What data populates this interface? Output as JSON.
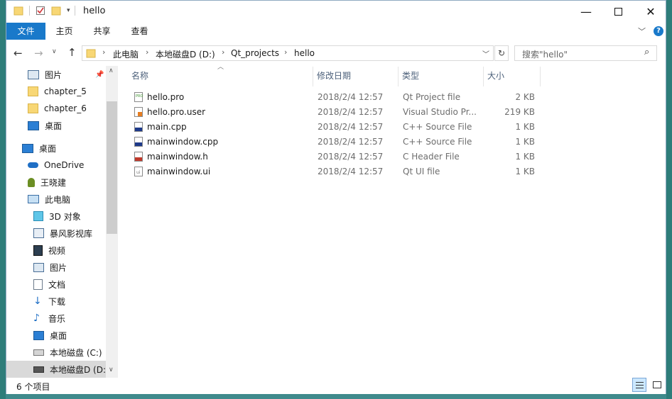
{
  "window": {
    "title": "hello"
  },
  "ribbon": {
    "tabs": [
      "文件",
      "主页",
      "共享",
      "查看"
    ]
  },
  "address": {
    "crumbs": [
      "此电脑",
      "本地磁盘D (D:)",
      "Qt_projects",
      "hello"
    ]
  },
  "search": {
    "placeholder": "搜索\"hello\""
  },
  "nav": {
    "items": [
      {
        "label": "图片",
        "icon": "pictures-icon"
      },
      {
        "label": "chapter_5",
        "icon": "folder-icon"
      },
      {
        "label": "chapter_6",
        "icon": "folder-icon"
      },
      {
        "label": "桌面",
        "icon": "desktop-icon"
      },
      {
        "label": "桌面",
        "icon": "desktop-icon"
      },
      {
        "label": "OneDrive",
        "icon": "onedrive-icon"
      },
      {
        "label": "王晓建",
        "icon": "user-icon"
      },
      {
        "label": "此电脑",
        "icon": "computer-icon"
      },
      {
        "label": "3D 对象",
        "icon": "3d-objects-icon"
      },
      {
        "label": "暴风影视库",
        "icon": "video-library-icon"
      },
      {
        "label": "视频",
        "icon": "video-icon"
      },
      {
        "label": "图片",
        "icon": "pictures-icon"
      },
      {
        "label": "文档",
        "icon": "documents-icon"
      },
      {
        "label": "下载",
        "icon": "downloads-icon"
      },
      {
        "label": "音乐",
        "icon": "music-icon"
      },
      {
        "label": "桌面",
        "icon": "desktop-icon"
      },
      {
        "label": "本地磁盘 (C:)",
        "icon": "drive-icon"
      },
      {
        "label": "本地磁盘D (D:",
        "icon": "drive-icon"
      }
    ]
  },
  "columns": {
    "name": "名称",
    "date": "修改日期",
    "type": "类型",
    "size": "大小"
  },
  "files": [
    {
      "name": "hello.pro",
      "date": "2018/2/4 12:57",
      "type": "Qt Project file",
      "size": "2 KB",
      "icon": "pro-file-icon"
    },
    {
      "name": "hello.pro.user",
      "date": "2018/2/4 12:57",
      "type": "Visual Studio Pr...",
      "size": "219 KB",
      "icon": "user-file-icon"
    },
    {
      "name": "main.cpp",
      "date": "2018/2/4 12:57",
      "type": "C++ Source File",
      "size": "1 KB",
      "icon": "cpp-file-icon"
    },
    {
      "name": "mainwindow.cpp",
      "date": "2018/2/4 12:57",
      "type": "C++ Source File",
      "size": "1 KB",
      "icon": "cpp-file-icon"
    },
    {
      "name": "mainwindow.h",
      "date": "2018/2/4 12:57",
      "type": "C Header File",
      "size": "1 KB",
      "icon": "h-file-icon"
    },
    {
      "name": "mainwindow.ui",
      "date": "2018/2/4 12:57",
      "type": "Qt UI file",
      "size": "1 KB",
      "icon": "ui-file-icon"
    }
  ],
  "status": {
    "count": "6 个项目"
  },
  "colors": {
    "accent": "#1979ca",
    "selection": "#cce8ff",
    "nav_selected": "#d9d9d9"
  }
}
